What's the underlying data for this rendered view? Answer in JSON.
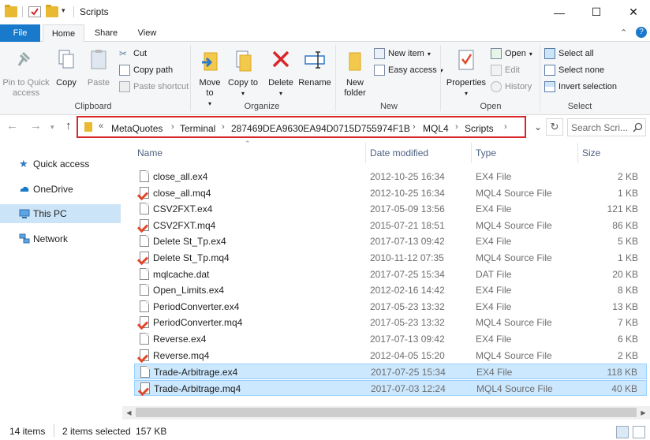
{
  "window": {
    "title": "Scripts",
    "controls": {
      "minimize": "—",
      "maximize": "☐",
      "close": "✕"
    }
  },
  "ribbon": {
    "tabs": [
      "File",
      "Home",
      "Share",
      "View"
    ],
    "clipboard": {
      "label": "Clipboard",
      "pin_to_quick_access": "Pin to Quick access",
      "copy": "Copy",
      "paste": "Paste",
      "cut": "Cut",
      "copy_path": "Copy path",
      "paste_shortcut": "Paste shortcut"
    },
    "organize": {
      "label": "Organize",
      "move_to": "Move to",
      "copy_to": "Copy to",
      "delete": "Delete",
      "rename": "Rename"
    },
    "new": {
      "label": "New",
      "new_folder": "New folder",
      "new_item": "New item",
      "easy_access": "Easy access"
    },
    "open": {
      "label": "Open",
      "properties": "Properties",
      "open": "Open",
      "edit": "Edit",
      "history": "History"
    },
    "select": {
      "label": "Select",
      "select_all": "Select all",
      "select_none": "Select none",
      "invert_selection": "Invert selection"
    }
  },
  "address": {
    "overflow": "«",
    "crumbs": [
      "MetaQuotes",
      "Terminal",
      "287469DEA9630EA94D0715D755974F1B",
      "MQL4",
      "Scripts"
    ],
    "search_placeholder": "Search Scri..."
  },
  "navpane": {
    "items": [
      "Quick access",
      "OneDrive",
      "This PC",
      "Network"
    ]
  },
  "columns": {
    "name": "Name",
    "date": "Date modified",
    "type": "Type",
    "size": "Size"
  },
  "files": [
    {
      "name": "close_all.ex4",
      "date": "2012-10-25 16:34",
      "type": "EX4 File",
      "size": "2 KB",
      "kind": "ex",
      "selected": false
    },
    {
      "name": "close_all.mq4",
      "date": "2012-10-25 16:34",
      "type": "MQL4 Source File",
      "size": "1 KB",
      "kind": "mq",
      "selected": false
    },
    {
      "name": "CSV2FXT.ex4",
      "date": "2017-05-09 13:56",
      "type": "EX4 File",
      "size": "121 KB",
      "kind": "ex",
      "selected": false
    },
    {
      "name": "CSV2FXT.mq4",
      "date": "2015-07-21 18:51",
      "type": "MQL4 Source File",
      "size": "86 KB",
      "kind": "mq",
      "selected": false
    },
    {
      "name": "Delete St_Tp.ex4",
      "date": "2017-07-13 09:42",
      "type": "EX4 File",
      "size": "5 KB",
      "kind": "ex",
      "selected": false
    },
    {
      "name": "Delete St_Tp.mq4",
      "date": "2010-11-12 07:35",
      "type": "MQL4 Source File",
      "size": "1 KB",
      "kind": "mq",
      "selected": false
    },
    {
      "name": "mqlcache.dat",
      "date": "2017-07-25 15:34",
      "type": "DAT File",
      "size": "20 KB",
      "kind": "ex",
      "selected": false
    },
    {
      "name": "Open_Limits.ex4",
      "date": "2012-02-16 14:42",
      "type": "EX4 File",
      "size": "8 KB",
      "kind": "ex",
      "selected": false
    },
    {
      "name": "PeriodConverter.ex4",
      "date": "2017-05-23 13:32",
      "type": "EX4 File",
      "size": "13 KB",
      "kind": "ex",
      "selected": false
    },
    {
      "name": "PeriodConverter.mq4",
      "date": "2017-05-23 13:32",
      "type": "MQL4 Source File",
      "size": "7 KB",
      "kind": "mq",
      "selected": false
    },
    {
      "name": "Reverse.ex4",
      "date": "2017-07-13 09:42",
      "type": "EX4 File",
      "size": "6 KB",
      "kind": "ex",
      "selected": false
    },
    {
      "name": "Reverse.mq4",
      "date": "2012-04-05 15:20",
      "type": "MQL4 Source File",
      "size": "2 KB",
      "kind": "mq",
      "selected": false
    },
    {
      "name": "Trade-Arbitrage.ex4",
      "date": "2017-07-25 15:34",
      "type": "EX4 File",
      "size": "118 KB",
      "kind": "ex",
      "selected": true
    },
    {
      "name": "Trade-Arbitrage.mq4",
      "date": "2017-07-03 12:24",
      "type": "MQL4 Source File",
      "size": "40 KB",
      "kind": "mq",
      "selected": true
    }
  ],
  "status": {
    "item_count": "14 items",
    "selection": "2 items selected",
    "selection_size": "157 KB"
  },
  "colors": {
    "accent": "#1979ca",
    "selection": "#cce8ff",
    "highlight_border": "#d9262a"
  }
}
